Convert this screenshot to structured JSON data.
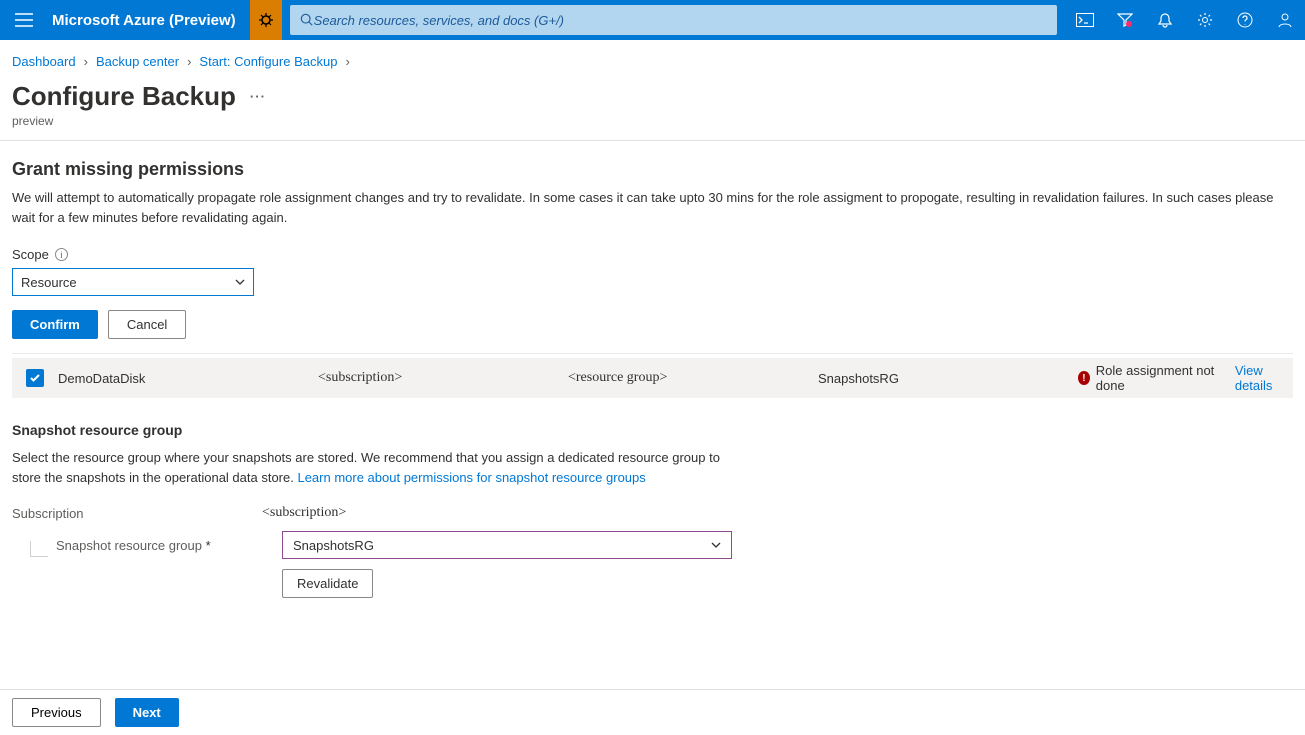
{
  "header": {
    "brand": "Microsoft Azure (Preview)",
    "search_placeholder": "Search resources, services, and docs (G+/)"
  },
  "breadcrumb": {
    "items": [
      "Dashboard",
      "Backup center",
      "Start: Configure Backup"
    ]
  },
  "page": {
    "title": "Configure Backup",
    "subtitle": "preview"
  },
  "permissions": {
    "title": "Grant missing permissions",
    "description": "We will attempt to automatically propagate role assignment changes and try to revalidate. In some cases it can take upto 30 mins for the role assigment to propogate, resulting in revalidation failures. In such cases please wait for a few minutes before revalidating again.",
    "scope_label": "Scope",
    "scope_value": "Resource",
    "confirm": "Confirm",
    "cancel": "Cancel"
  },
  "table": {
    "row": {
      "checked": true,
      "name": "DemoDataDisk",
      "subscription": "<subscription>",
      "resource_group": "<resource group>",
      "snapshot_rg": "SnapshotsRG",
      "status": "Role assignment not done",
      "view": "View details"
    }
  },
  "snapshot": {
    "title": "Snapshot resource group",
    "desc_text": "Select the resource group where your snapshots are stored. We recommend that you assign a dedicated resource group to store the snapshots in the operational data store. ",
    "desc_link": "Learn more about permissions for snapshot resource groups",
    "subscription_label": "Subscription",
    "subscription_value": "<subscription>",
    "rg_label": "Snapshot resource group",
    "rg_value": "SnapshotsRG",
    "revalidate": "Revalidate"
  },
  "footer": {
    "previous": "Previous",
    "next": "Next"
  }
}
